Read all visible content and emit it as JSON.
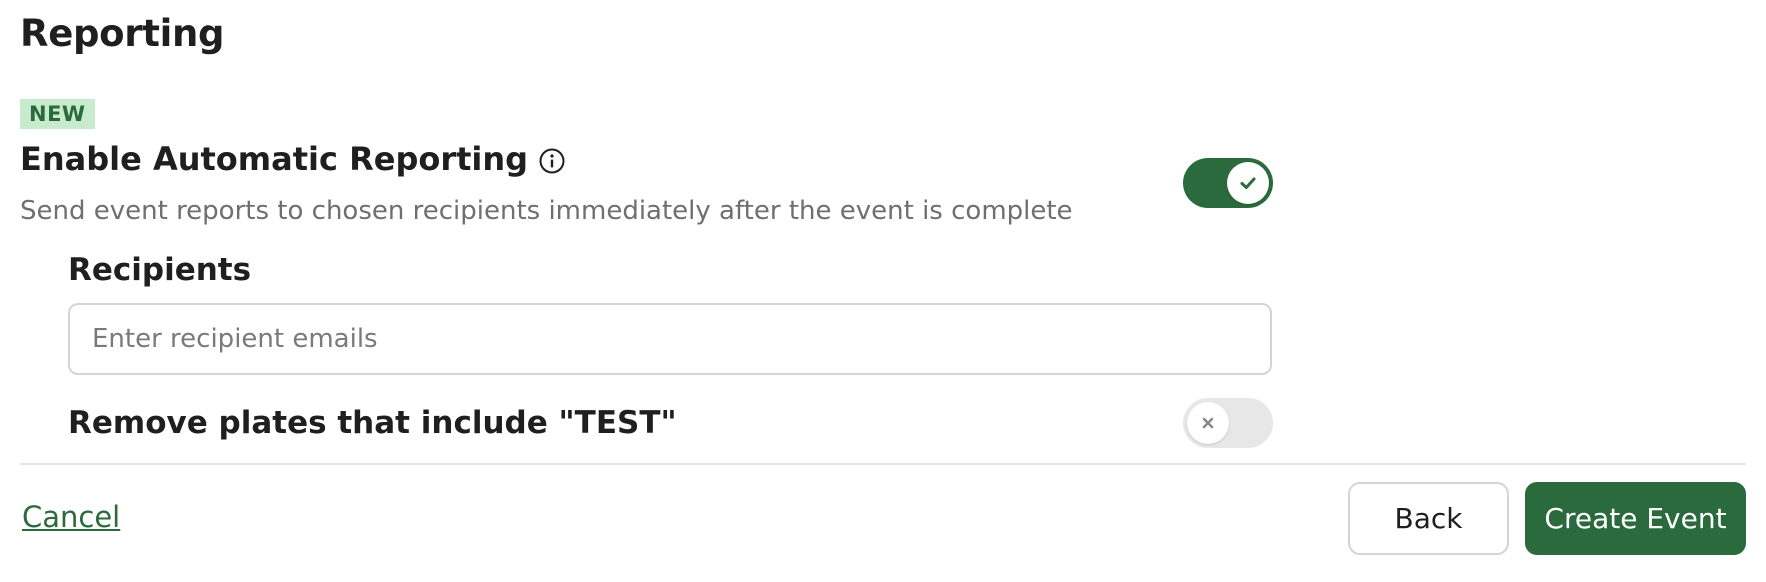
{
  "section": {
    "title": "Reporting"
  },
  "badge": {
    "label": "NEW"
  },
  "automatic_reporting": {
    "title": "Enable Automatic Reporting",
    "description": "Send event reports to chosen recipients immediately after the event is complete",
    "enabled": true,
    "info_icon": "info-icon"
  },
  "recipients": {
    "label": "Recipients",
    "placeholder": "Enter recipient emails",
    "value": ""
  },
  "remove_test_plates": {
    "label": "Remove plates that include \"TEST\"",
    "enabled": false
  },
  "footer": {
    "cancel_label": "Cancel",
    "back_label": "Back",
    "create_label": "Create Event"
  },
  "colors": {
    "brand": "#2b6a3d",
    "badge_bg": "#c9ebcd",
    "muted_text": "#6f6f6f",
    "toggle_off": "#e7e7e7"
  }
}
